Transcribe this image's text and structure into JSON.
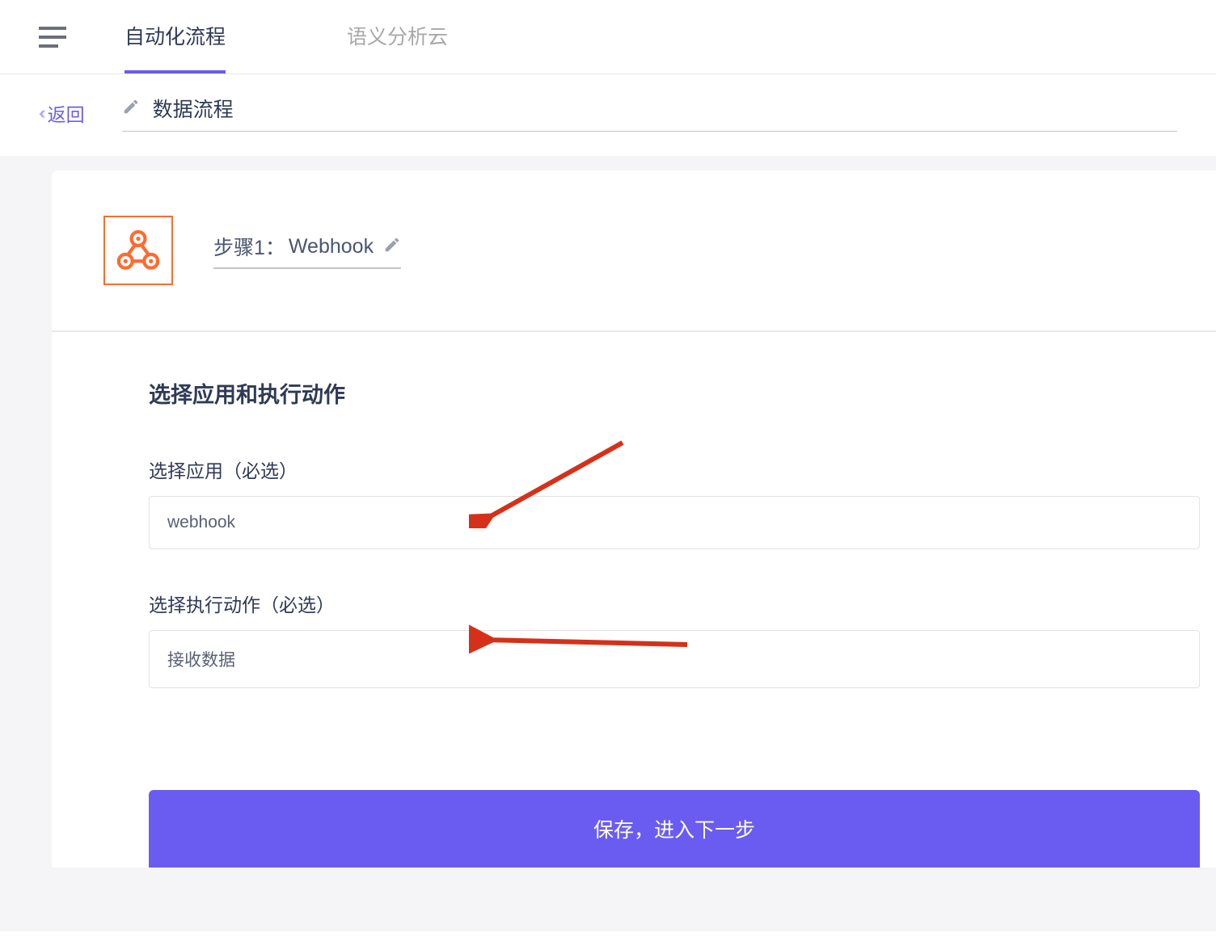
{
  "header": {
    "tabs": [
      {
        "label": "自动化流程",
        "active": true
      },
      {
        "label": "语义分析云",
        "active": false
      }
    ]
  },
  "subheader": {
    "back_label": "返回",
    "page_title": "数据流程"
  },
  "step": {
    "prefix": "步骤1：",
    "title": "Webhook"
  },
  "form": {
    "heading": "选择应用和执行动作",
    "app_label": "选择应用（必选）",
    "app_value": "webhook",
    "action_label": "选择执行动作（必选）",
    "action_value": "接收数据",
    "submit_label": "保存，进入下一步"
  }
}
